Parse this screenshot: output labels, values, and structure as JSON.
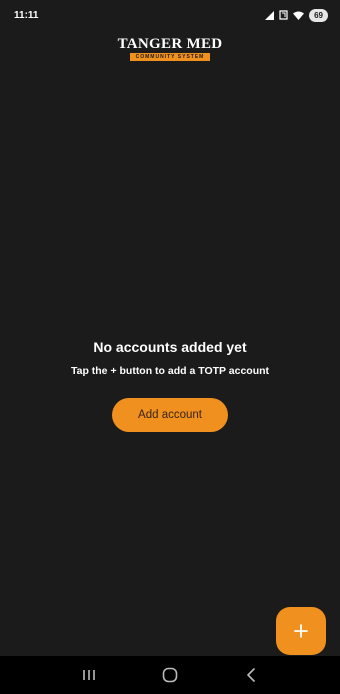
{
  "status_bar": {
    "time": "11:11",
    "battery": "69"
  },
  "logo": {
    "title": "TANGER MED",
    "subtitle": "COMMUNITY SYSTEM"
  },
  "empty_state": {
    "title": "No accounts added yet",
    "subtitle": "Tap the + button to add a TOTP account",
    "button_label": "Add account"
  },
  "fab": {
    "icon": "plus-icon"
  },
  "nav_bar": {
    "icons": [
      "recent-apps-icon",
      "home-icon",
      "back-icon"
    ]
  },
  "colors": {
    "background": "#1b1b1b",
    "accent": "#f0901e",
    "text": "#ffffff"
  }
}
